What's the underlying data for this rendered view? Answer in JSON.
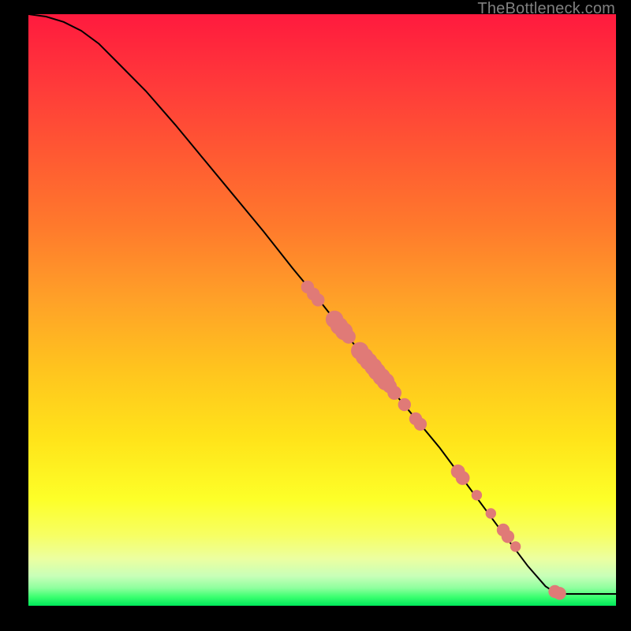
{
  "attribution": "TheBottleneck.com",
  "colors": {
    "dot": "#e07a77",
    "curve": "#000000",
    "frame": "#000000",
    "gradient_top": "#ff1a3e",
    "gradient_bottom": "#00e85a"
  },
  "chart_data": {
    "type": "line",
    "title": "",
    "xlabel": "",
    "ylabel": "",
    "xlim": [
      0,
      100
    ],
    "ylim": [
      0,
      100
    ],
    "grid": false,
    "legend": false,
    "note": "No axes, ticks, or legend are visible. x and y values are normalized to 0–100 of the plot area (0,0 = bottom-left). Estimated from pixel positions.",
    "series": [
      {
        "name": "curve",
        "type": "line",
        "x": [
          0,
          3,
          6,
          9,
          12,
          15,
          20,
          25,
          30,
          35,
          40,
          45,
          50,
          55,
          60,
          65,
          70,
          75,
          80,
          85,
          88,
          90,
          100
        ],
        "y": [
          100,
          99.6,
          98.7,
          97.2,
          95.0,
          92.0,
          87.0,
          81.3,
          75.3,
          69.3,
          63.3,
          57.0,
          51.0,
          44.7,
          38.7,
          32.7,
          26.7,
          20.0,
          13.3,
          6.7,
          3.3,
          2.0,
          2.0
        ]
      },
      {
        "name": "marked-points",
        "type": "scatter",
        "note": "Red dots lying on the curve; some dots are larger/elongated indicating dense clusters.",
        "points": [
          {
            "x": 47.5,
            "y": 53.9,
            "r": 1.1
          },
          {
            "x": 48.5,
            "y": 52.7,
            "r": 1.1
          },
          {
            "x": 49.3,
            "y": 51.7,
            "r": 1.1
          },
          {
            "x": 52.1,
            "y": 48.4,
            "r": 1.5
          },
          {
            "x": 52.9,
            "y": 47.3,
            "r": 1.5
          },
          {
            "x": 53.7,
            "y": 46.4,
            "r": 1.5
          },
          {
            "x": 54.5,
            "y": 45.5,
            "r": 1.2
          },
          {
            "x": 56.4,
            "y": 43.1,
            "r": 1.5
          },
          {
            "x": 57.2,
            "y": 42.1,
            "r": 1.5
          },
          {
            "x": 57.9,
            "y": 41.3,
            "r": 1.5
          },
          {
            "x": 58.7,
            "y": 40.4,
            "r": 1.5
          },
          {
            "x": 59.3,
            "y": 39.6,
            "r": 1.5
          },
          {
            "x": 60.1,
            "y": 38.7,
            "r": 1.5
          },
          {
            "x": 60.8,
            "y": 37.9,
            "r": 1.5
          },
          {
            "x": 61.5,
            "y": 37.1,
            "r": 1.2
          },
          {
            "x": 62.3,
            "y": 36.0,
            "r": 1.2
          },
          {
            "x": 64.0,
            "y": 34.0,
            "r": 1.1
          },
          {
            "x": 65.9,
            "y": 31.6,
            "r": 1.1
          },
          {
            "x": 66.7,
            "y": 30.7,
            "r": 1.1
          },
          {
            "x": 73.1,
            "y": 22.7,
            "r": 1.2
          },
          {
            "x": 73.9,
            "y": 21.6,
            "r": 1.2
          },
          {
            "x": 76.3,
            "y": 18.7,
            "r": 0.9
          },
          {
            "x": 78.7,
            "y": 15.6,
            "r": 0.9
          },
          {
            "x": 80.8,
            "y": 12.8,
            "r": 1.1
          },
          {
            "x": 81.6,
            "y": 11.7,
            "r": 1.1
          },
          {
            "x": 82.9,
            "y": 10.0,
            "r": 0.9
          },
          {
            "x": 89.6,
            "y": 2.4,
            "r": 1.1
          },
          {
            "x": 90.4,
            "y": 2.1,
            "r": 1.1
          }
        ]
      }
    ]
  }
}
